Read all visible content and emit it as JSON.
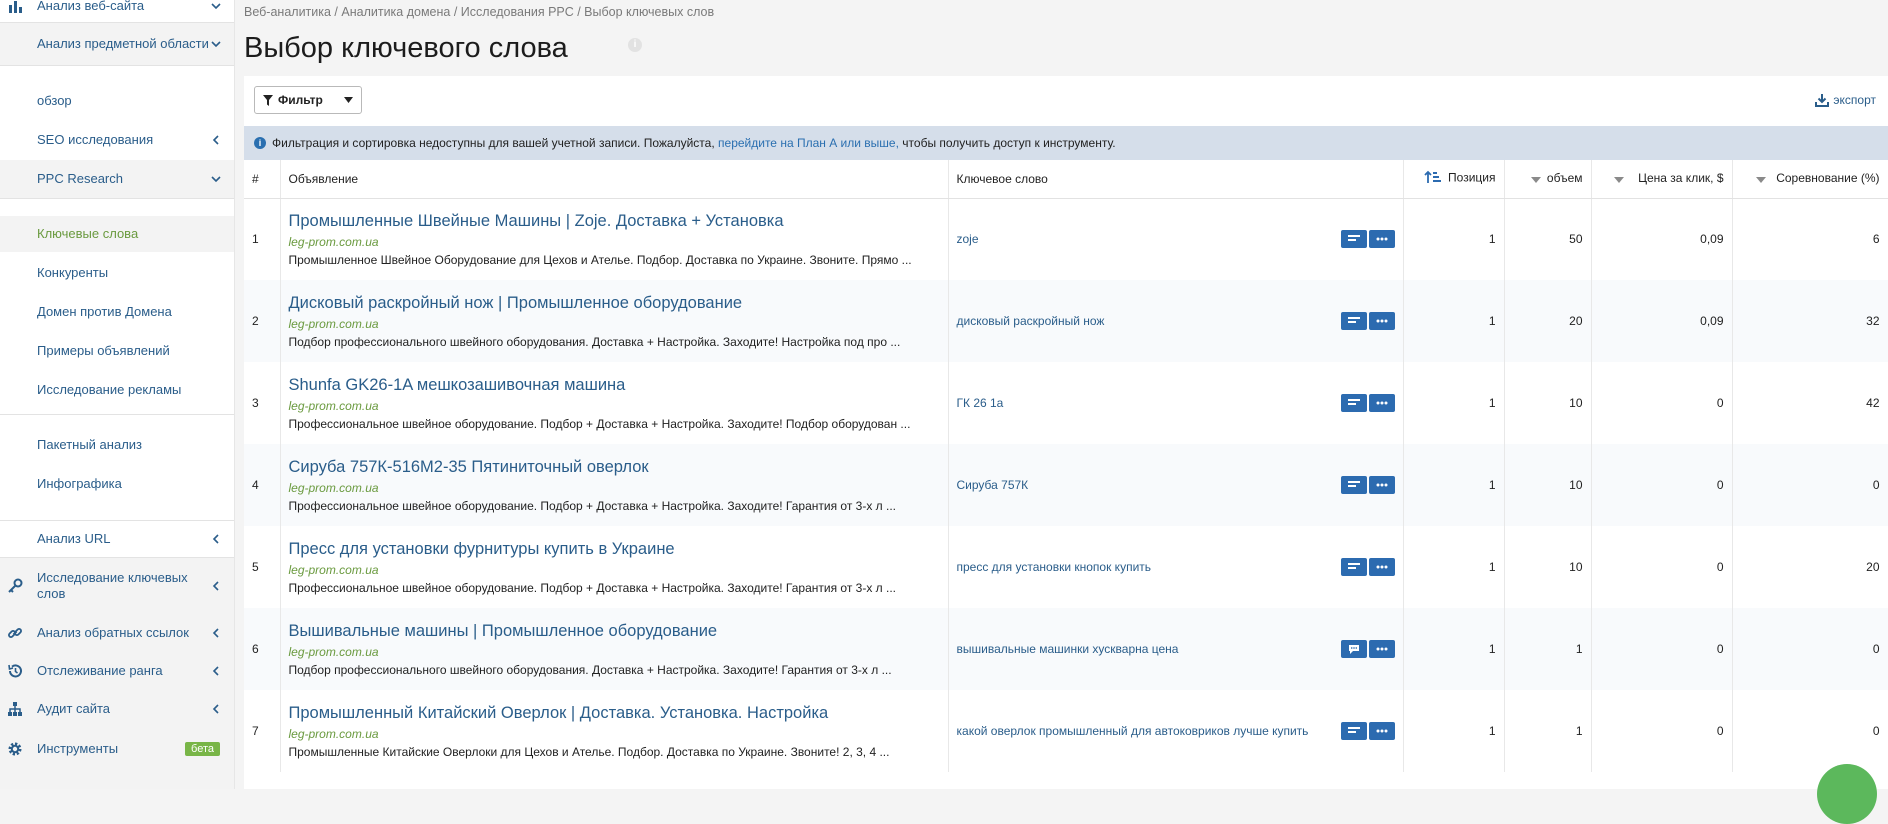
{
  "sidebar": {
    "items": [
      {
        "label": "Анализ веб-сайта",
        "icon": "bar-chart-icon",
        "chevron": "down"
      },
      {
        "label": "Анализ предметной области",
        "chevron": "down"
      },
      {
        "label": "обзор"
      },
      {
        "label": "SEO исследования",
        "chevron": "left"
      },
      {
        "label": "PPC Research",
        "chevron": "down"
      },
      {
        "label": "Ключевые слова",
        "active": true
      },
      {
        "label": "Конкуренты"
      },
      {
        "label": "Домен против Домена"
      },
      {
        "label": "Примеры объявлений"
      },
      {
        "label": "Исследование рекламы"
      },
      {
        "label": "Пакетный анализ"
      },
      {
        "label": "Инфографика"
      },
      {
        "label": "Анализ URL",
        "chevron": "left"
      },
      {
        "label": "Исследование ключевых слов",
        "icon": "key-icon",
        "chevron": "left"
      },
      {
        "label": "Анализ обратных ссылок",
        "icon": "link-icon",
        "chevron": "left"
      },
      {
        "label": "Отслеживание ранга",
        "icon": "history-icon",
        "chevron": "left"
      },
      {
        "label": "Аудит сайта",
        "icon": "sitemap-icon",
        "chevron": "left"
      },
      {
        "label": "Инструменты",
        "icon": "gear-icon",
        "badge": "бета"
      }
    ]
  },
  "breadcrumb": "Веб-аналитика / Аналитика домена / Исследования PPC / Выбор ключевых слов",
  "page_title": "Выбор ключевого слова",
  "toolbar": {
    "filter_label": "Фильтр",
    "export_label": "экспорт"
  },
  "notice": {
    "text_before": "Фильтрация и сортировка недоступны для вашей учетной записи. Пожалуйста,",
    "link": "перейдите на План А или выше,",
    "text_after": "чтобы получить доступ к инструменту."
  },
  "table": {
    "headers": {
      "num": "#",
      "ad": "Объявление",
      "keyword": "Ключевое слово",
      "position": "Позиция",
      "volume": "объем",
      "cpc": "Цена за клик, $",
      "competition": "Соревнование (%)"
    },
    "rows": [
      {
        "n": "1",
        "title": "Промышленные Швейные Машины | Zoje. Доставка + Установка",
        "url": "leg-prom.com.ua",
        "desc": "Промышленное Швейное Оборудование для Цехов и Ателье. Подбор. Доставка по Украине. Звоните. Прямо ...",
        "keyword": "zoje",
        "position": "1",
        "volume": "50",
        "cpc": "0,09",
        "competition": "6",
        "first_btn_icon": "lines-icon"
      },
      {
        "n": "2",
        "title": "Дисковый раскройный нож | Промышленное оборудование",
        "url": "leg-prom.com.ua",
        "desc": "Подбор профессионального швейного оборудования. Доставка + Настройка. Заходите! Настройка под про ...",
        "keyword": "дисковый раскройный нож",
        "position": "1",
        "volume": "20",
        "cpc": "0,09",
        "competition": "32",
        "first_btn_icon": "lines-icon"
      },
      {
        "n": "3",
        "title": "Shunfa GK26-1A мешкозашивочная машина",
        "url": "leg-prom.com.ua",
        "desc": "Профессиональное швейное оборудование. Подбор + Доставка + Настройка. Заходите! Подбор оборудован ...",
        "keyword": "ГК 26 1а",
        "position": "1",
        "volume": "10",
        "cpc": "0",
        "competition": "42",
        "first_btn_icon": "lines-icon"
      },
      {
        "n": "4",
        "title": "Сируба 757К-516М2-35 Пятиниточный оверлок",
        "url": "leg-prom.com.ua",
        "desc": "Профессиональное швейное оборудование. Подбор + Доставка + Настройка. Заходите! Гарантия от 3-х л ...",
        "keyword": "Сируба 757К",
        "position": "1",
        "volume": "10",
        "cpc": "0",
        "competition": "0",
        "first_btn_icon": "lines-icon"
      },
      {
        "n": "5",
        "title": "Пресс для установки фурнитуры купить в Украине",
        "url": "leg-prom.com.ua",
        "desc": "Профессиональное швейное оборудование. Подбор + Доставка + Настройка. Заходите! Гарантия от 3-х л ...",
        "keyword": "пресс для установки кнопок купить",
        "position": "1",
        "volume": "10",
        "cpc": "0",
        "competition": "20",
        "first_btn_icon": "lines-icon"
      },
      {
        "n": "6",
        "title": "Вышивальные машины | Промышленное оборудование",
        "url": "leg-prom.com.ua",
        "desc": "Подбор профессионального швейного оборудования. Доставка + Настройка. Заходите! Гарантия от 3-х л ...",
        "keyword": "вышивальные машинки хускварна цена",
        "position": "1",
        "volume": "1",
        "cpc": "0",
        "competition": "0",
        "first_btn_icon": "comment-icon"
      },
      {
        "n": "7",
        "title": "Промышленный Китайский Оверлок | Доставка. Установка. Настройка",
        "url": "leg-prom.com.ua",
        "desc": "Промышленные Китайские Оверлоки для Цехов и Ателье. Подбор. Доставка по Украине. Звоните! 2, 3, 4 ...",
        "keyword": "какой оверлок промышленный для автоковриков лучше купить",
        "position": "1",
        "volume": "1",
        "cpc": "0",
        "competition": "0",
        "first_btn_icon": "lines-icon"
      }
    ]
  },
  "colors": {
    "link": "#2a5d8a",
    "url_green": "#6a9a3f",
    "button_blue": "#2c6bb0",
    "notice_bg": "#d5deea",
    "beta_green": "#78b547"
  }
}
